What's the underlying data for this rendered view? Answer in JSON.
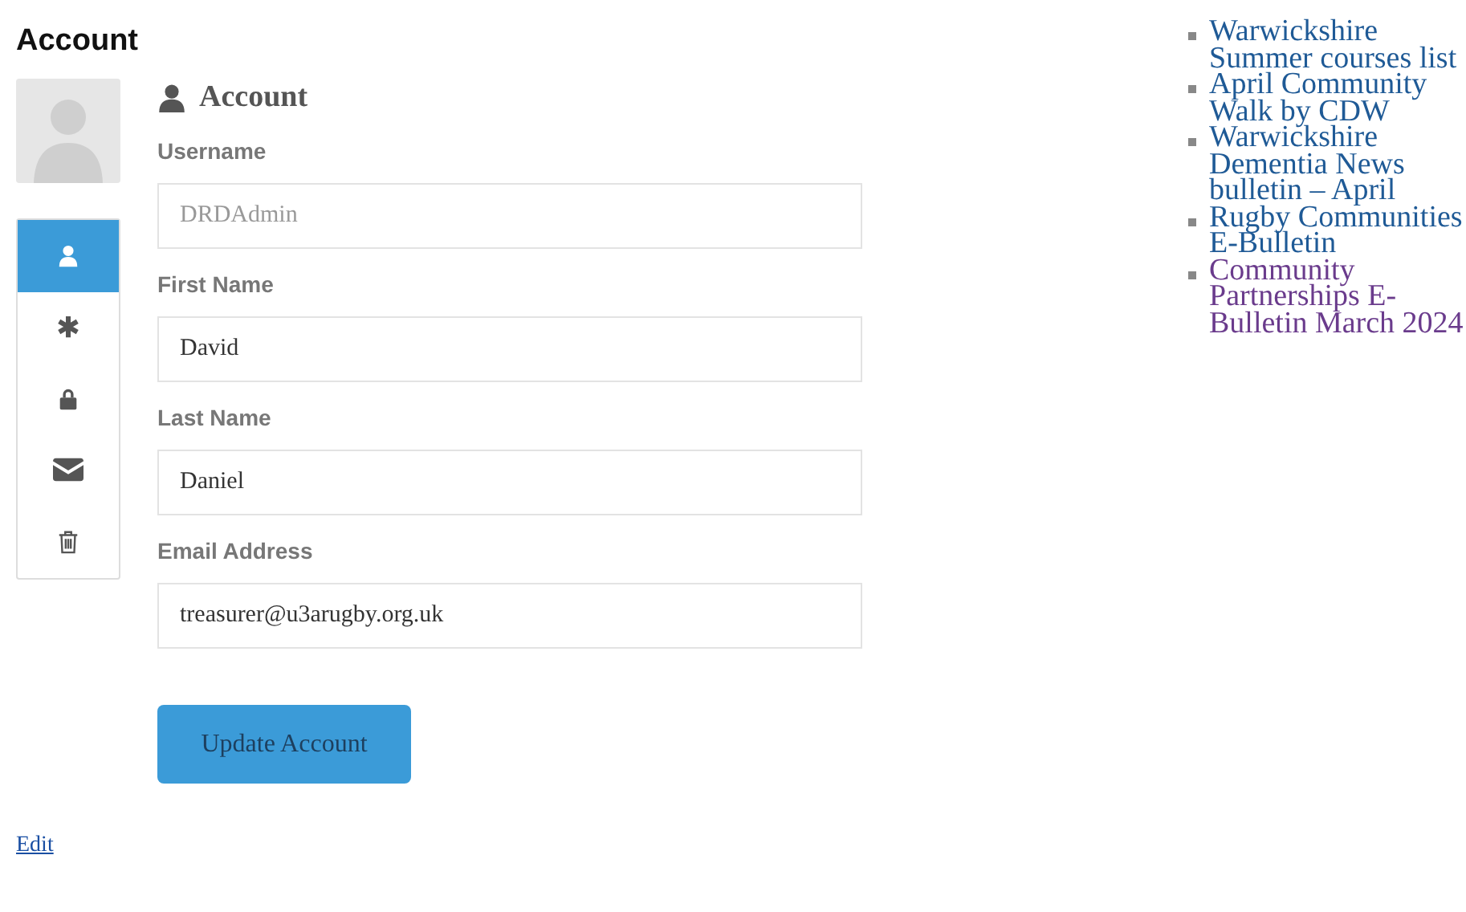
{
  "page_title": "Account",
  "tabs": [
    {
      "kind": "user",
      "selected": true
    },
    {
      "kind": "asterisk",
      "selected": false
    },
    {
      "kind": "lock",
      "selected": false
    },
    {
      "kind": "envelope",
      "selected": false
    },
    {
      "kind": "trash",
      "selected": false
    }
  ],
  "section_title": "Account",
  "fields": [
    {
      "label": "Username",
      "value": "DRDAdmin",
      "disabled": true
    },
    {
      "label": "First Name",
      "value": "David",
      "disabled": false
    },
    {
      "label": "Last Name",
      "value": "Daniel",
      "disabled": false
    },
    {
      "label": "Email Address",
      "value": "treasurer@u3arugby.org.uk",
      "disabled": false
    }
  ],
  "submit_button": "Update Account",
  "edit_link": "Edit",
  "links": [
    {
      "text": "Warwickshire Summer courses list",
      "visited": false
    },
    {
      "text": "April Community Walk by CDW",
      "visited": false
    },
    {
      "text": "Warwickshire Dementia News bulletin – April",
      "visited": false
    },
    {
      "text": "Rugby Communities E-Bulletin",
      "visited": false
    },
    {
      "text": "Community Partnerships E-Bulletin March 2024",
      "visited": true
    }
  ]
}
